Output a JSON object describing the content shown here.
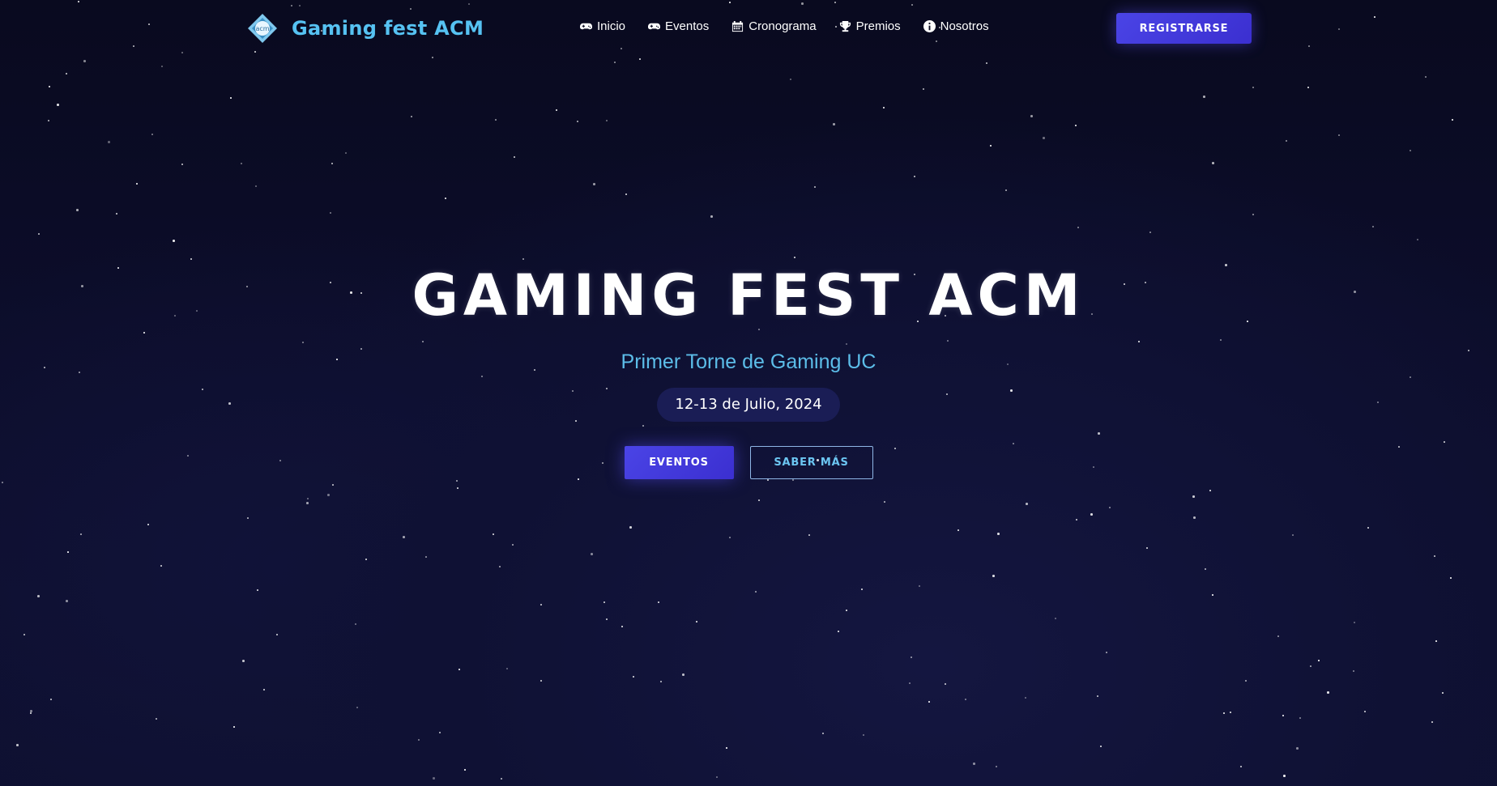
{
  "nav": {
    "brand_name": "Gaming fest ACM",
    "logo_text": "acm",
    "items": [
      {
        "label": "Inicio",
        "icon": "gamepad-icon"
      },
      {
        "label": "Eventos",
        "icon": "gamepad-icon"
      },
      {
        "label": "Cronograma",
        "icon": "calendar-icon"
      },
      {
        "label": "Premios",
        "icon": "trophy-icon"
      },
      {
        "label": "Nosotros",
        "icon": "info-icon"
      }
    ],
    "register_label": "REGISTRARSE"
  },
  "hero": {
    "title": "GAMING FEST ACM",
    "subtitle": "Primer Torne de Gaming UC",
    "date": "12-13 de Julio, 2024",
    "primary_button": "EVENTOS",
    "secondary_button": "SABER MÁS"
  },
  "colors": {
    "background": "#0b0c26",
    "accent_blue": "#56c2f2",
    "button_purple": "#4a44e6",
    "date_pill": "#1a1d55"
  }
}
